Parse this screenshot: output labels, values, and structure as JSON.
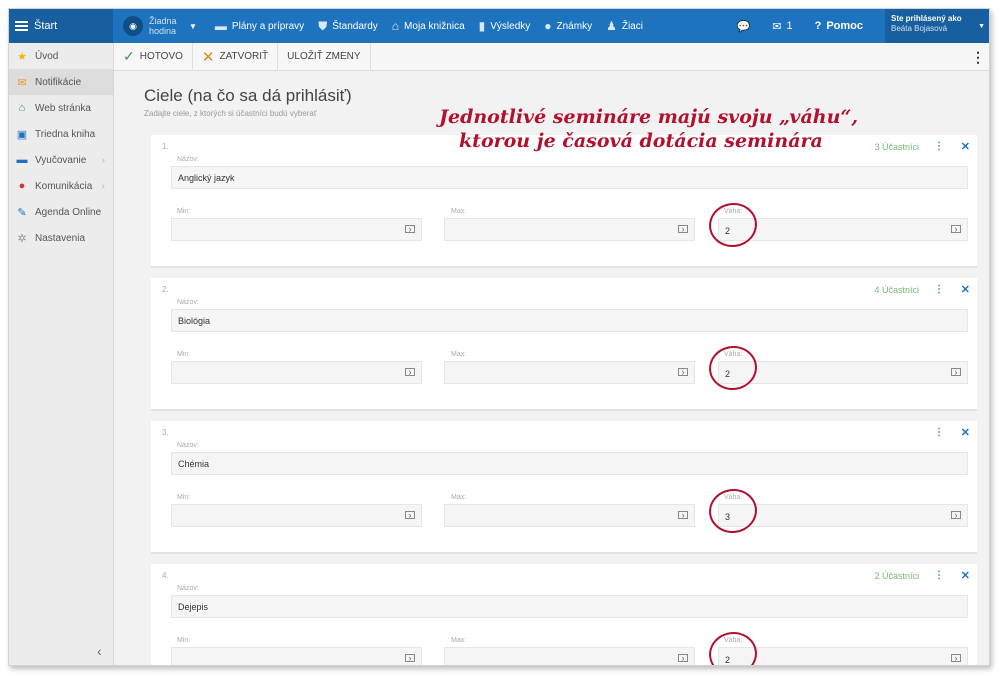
{
  "topbar": {
    "start_label": "Štart",
    "hodina_label": "Žiadna hodina",
    "nav": [
      {
        "label": "Plány a prípravy",
        "icon": "folder-icon",
        "glyph": "▬"
      },
      {
        "label": "Štandardy",
        "icon": "shield-icon",
        "glyph": "⛊"
      },
      {
        "label": "Moja knižnica",
        "icon": "library-icon",
        "glyph": "⌂"
      },
      {
        "label": "Výsledky",
        "icon": "bar-chart-icon",
        "glyph": "▮"
      },
      {
        "label": "Známky",
        "icon": "grades-icon",
        "glyph": "●"
      },
      {
        "label": "Žiaci",
        "icon": "students-icon",
        "glyph": "♟"
      }
    ],
    "messages_count": "1",
    "help_label": "Pomoc",
    "user_prefix": "Ste prihlásený ako",
    "user_name": "Beáta Bojasová"
  },
  "sidebar": {
    "items": [
      {
        "label": "Úvod",
        "icon": "star-icon",
        "glyph": "★",
        "color": "#f2b705"
      },
      {
        "label": "Notifikácie",
        "icon": "envelope-icon",
        "glyph": "✉",
        "color": "#f29a1f"
      },
      {
        "label": "Web stránka",
        "icon": "home-icon",
        "glyph": "⌂",
        "color": "#2e9b57"
      },
      {
        "label": "Triedna kniha",
        "icon": "book-icon",
        "glyph": "▣",
        "color": "#1e73be"
      },
      {
        "label": "Vyučovanie",
        "icon": "briefcase-icon",
        "glyph": "▬",
        "color": "#1e73be"
      },
      {
        "label": "Komunikácia",
        "icon": "chat-icon",
        "glyph": "●",
        "color": "#d9372b"
      },
      {
        "label": "Agenda Online",
        "icon": "pen-icon",
        "glyph": "✎",
        "color": "#1e73be"
      },
      {
        "label": "Nastavenia",
        "icon": "gear-icon",
        "glyph": "✲",
        "color": "#999999"
      }
    ]
  },
  "toolbar": {
    "done_label": "HOTOVO",
    "close_label": "ZATVORIŤ",
    "save_label": "ULOŽIŤ ZMENY"
  },
  "page": {
    "title": "Ciele (na čo sa dá prihlásiť)",
    "subtitle": "Zadajte ciele, z ktorých si účastníci budú vyberať"
  },
  "labels": {
    "nazov": "Názov:",
    "min": "Min:",
    "max": "Max:",
    "vaha": "Váha:"
  },
  "cards": [
    {
      "num": "1.",
      "count": "3 Účastníci",
      "nazov": "Anglický jazyk",
      "min": "",
      "max": "",
      "vaha": "2"
    },
    {
      "num": "2.",
      "count": "4 Účastníci",
      "nazov": "Biológia",
      "min": "",
      "max": "",
      "vaha": "2"
    },
    {
      "num": "3.",
      "count": "",
      "nazov": "Chémia",
      "min": "",
      "max": "",
      "vaha": "3"
    },
    {
      "num": "4.",
      "count": "2 Účastníci",
      "nazov": "Dejepis",
      "min": "",
      "max": "",
      "vaha": "2"
    }
  ],
  "annotation": {
    "line1": "Jednotlivé semináre majú svoju „váhu“,",
    "line2": "ktorou je časová dotácia seminára"
  }
}
